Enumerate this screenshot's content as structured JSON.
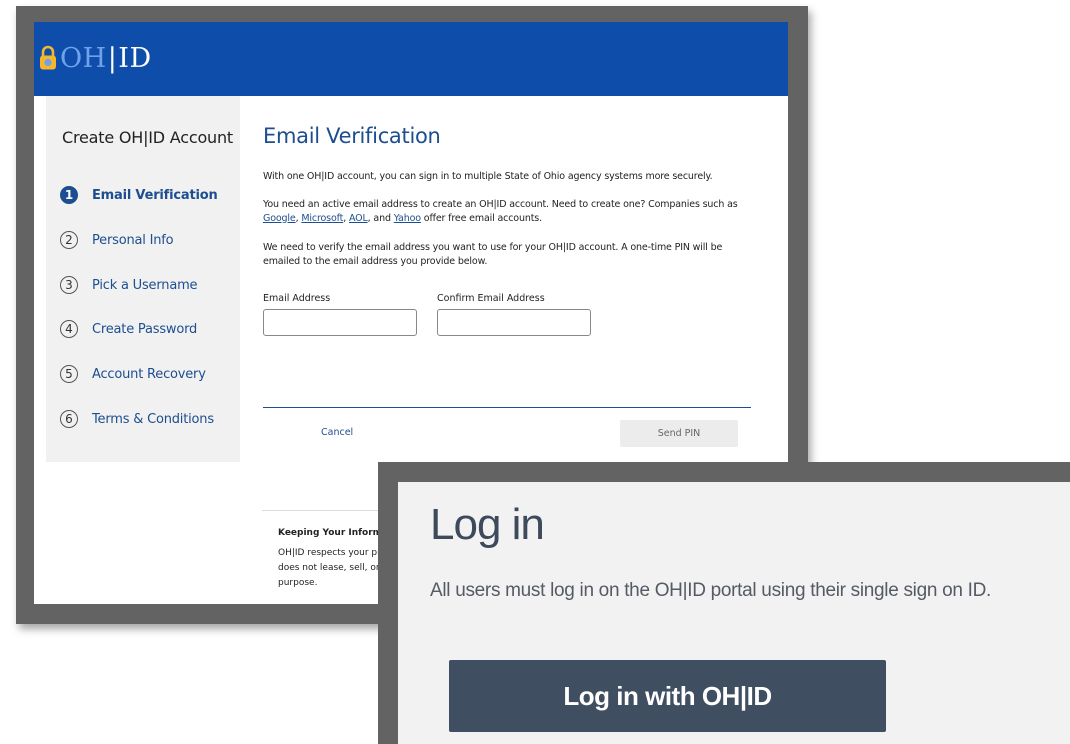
{
  "app": {
    "logo_oh": "OH",
    "logo_bar": "|",
    "logo_id": "ID"
  },
  "sidebar": {
    "title": "Create OH|ID Account",
    "steps": [
      {
        "num": "1",
        "label": "Email Verification",
        "active": true
      },
      {
        "num": "2",
        "label": "Personal Info"
      },
      {
        "num": "3",
        "label": "Pick a Username"
      },
      {
        "num": "4",
        "label": "Create Password"
      },
      {
        "num": "5",
        "label": "Account Recovery"
      },
      {
        "num": "6",
        "label": "Terms & Conditions"
      }
    ]
  },
  "main": {
    "title": "Email Verification",
    "intro": "With one OH|ID account, you can sign in to multiple State of Ohio agency systems more securely.",
    "need_email_prefix": "You need an active email address to create an OH|ID account. Need to create one? Companies such as ",
    "links": {
      "google": "Google",
      "microsoft": "Microsoft",
      "aol": "AOL",
      "yahoo": "Yahoo"
    },
    "sep_comma": ", ",
    "sep_and": ", and ",
    "need_email_suffix": " offer free email accounts.",
    "verify_text": "We need to verify the email address you want to use for your OH|ID account. A one-time PIN will be emailed to the email address you provide below.",
    "email_label": "Email Address",
    "email_value": "",
    "confirm_label": "Confirm Email Address",
    "confirm_value": "",
    "cancel_label": "Cancel",
    "send_pin_label": "Send PIN"
  },
  "footer": {
    "title": "Keeping Your Informat",
    "text_line1": "OH|ID respects your pri",
    "text_line2": "does not lease, sell, or",
    "text_line3": "purpose."
  },
  "login": {
    "title": "Log in",
    "subtitle": "All users must log in on the OH|ID portal using their single sign on ID.",
    "button_label": "Log in with OH|ID"
  },
  "colors": {
    "header_blue": "#0e4eaa",
    "accent_blue": "#1d4e8f",
    "login_button": "#3f4e61",
    "frame_gray": "#636363"
  }
}
